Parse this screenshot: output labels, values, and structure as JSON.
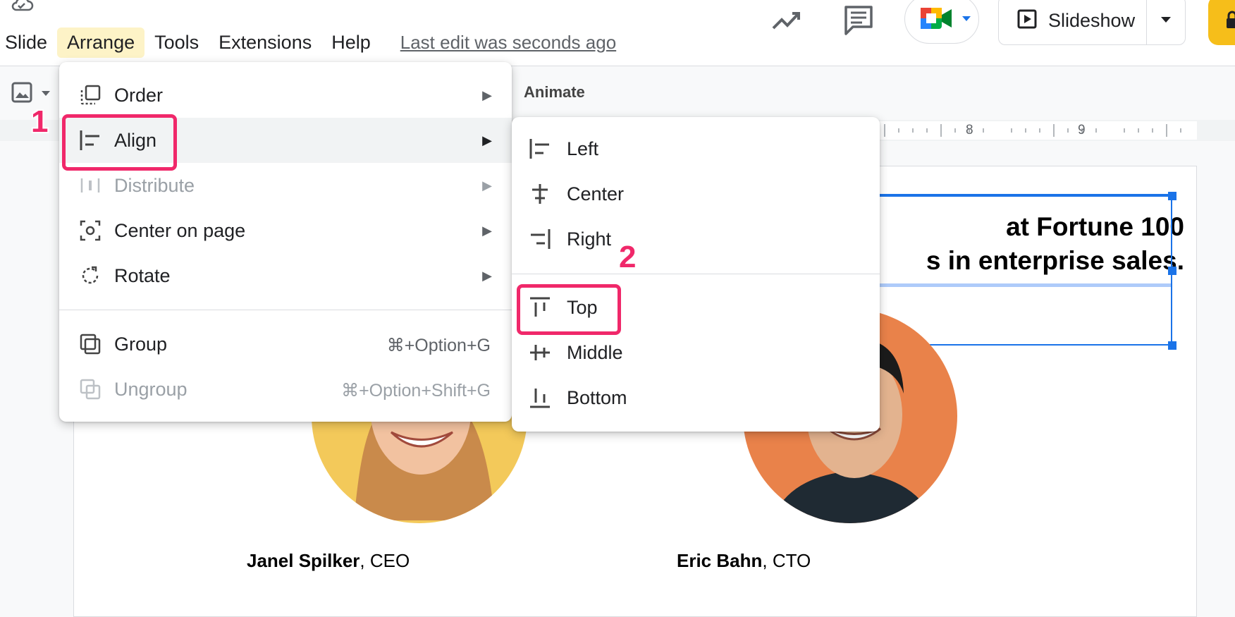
{
  "menubar": {
    "items": [
      "Slide",
      "Arrange",
      "Tools",
      "Extensions",
      "Help"
    ],
    "last_edit": "Last edit was seconds ago"
  },
  "header": {
    "slideshow_label": "Slideshow"
  },
  "toolbar": {
    "animate_label": "Animate"
  },
  "ruler": {
    "labels": [
      "8",
      "9"
    ]
  },
  "arrange_menu": {
    "items": [
      {
        "label": "Order",
        "icon": "order-icon",
        "submenu": true
      },
      {
        "label": "Align",
        "icon": "align-left-icon",
        "submenu": true,
        "highlighted": true
      },
      {
        "label": "Distribute",
        "icon": "distribute-icon",
        "submenu": true,
        "disabled": true
      },
      {
        "label": "Center on page",
        "icon": "center-on-page-icon",
        "submenu": true
      },
      {
        "label": "Rotate",
        "icon": "rotate-icon",
        "submenu": true
      },
      {
        "label": "Group",
        "icon": "group-icon",
        "shortcut": "⌘+Option+G"
      },
      {
        "label": "Ungroup",
        "icon": "ungroup-icon",
        "shortcut": "⌘+Option+Shift+G",
        "disabled": true
      }
    ]
  },
  "align_submenu": {
    "items": [
      {
        "label": "Left",
        "icon": "align-left-icon"
      },
      {
        "label": "Center",
        "icon": "align-center-icon"
      },
      {
        "label": "Right",
        "icon": "align-right-icon"
      },
      {
        "label": "Top",
        "icon": "align-top-icon"
      },
      {
        "label": "Middle",
        "icon": "align-middle-icon"
      },
      {
        "label": "Bottom",
        "icon": "align-bottom-icon"
      }
    ]
  },
  "slide": {
    "headline": "at Fortune 100\ns in enterprise sales.",
    "captions": [
      {
        "name": "Janel Spilker",
        "role": ", CEO"
      },
      {
        "name": "Eric Bahn",
        "role": ", CTO"
      }
    ]
  },
  "annotations": {
    "step1": "1",
    "step2": "2",
    "highlight_color": "#f0286a"
  },
  "colors": {
    "menu_active_bg": "#fdf3c7",
    "selection_blue": "#1a73e8",
    "share_yellow": "#f6be1a"
  }
}
